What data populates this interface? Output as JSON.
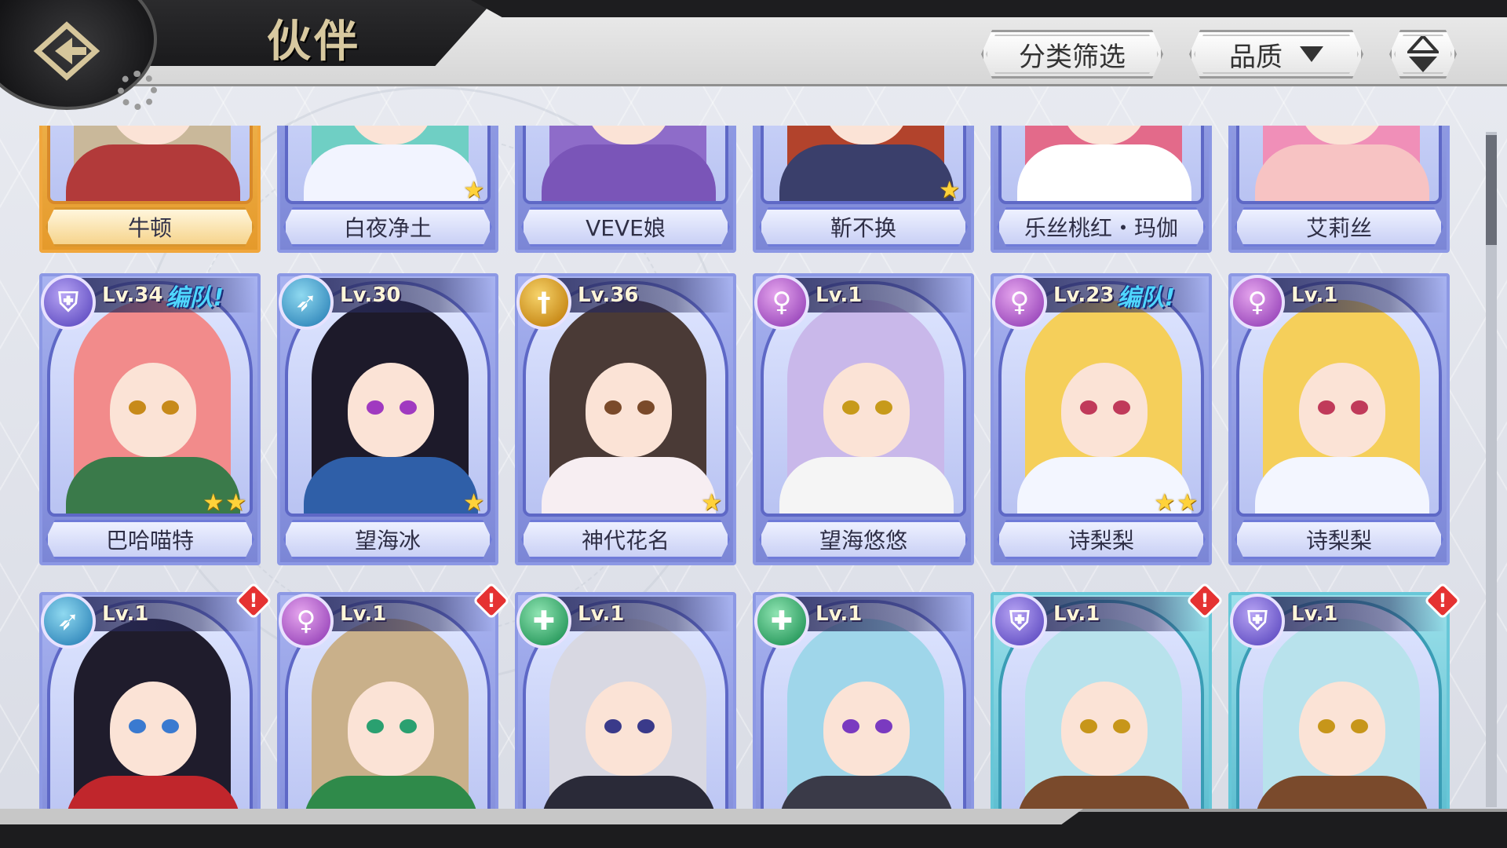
{
  "header": {
    "title": "伙伴",
    "filter_label": "分类筛选",
    "quality_label": "品质"
  },
  "colors": {
    "card_purple": "#8c98e4",
    "card_gold": "#f0a63c",
    "card_teal": "#67c7d8",
    "team_tag": "#4fd6ff",
    "level_text": "#fff6d8",
    "alert": "#e53232"
  },
  "scroll": {
    "position_fraction": 0.0
  },
  "rows": [
    {
      "cards": [
        {
          "name": "牛顿",
          "style": "gold",
          "stars": 0,
          "hair": "#c9b89a",
          "body": "#b23a3a",
          "eyes": "#6b4a2c"
        },
        {
          "name": "白夜净土",
          "style": "purple",
          "stars": 1,
          "hair": "#6fcfc4",
          "body": "#f2f4ff",
          "eyes": "#2a7f86"
        },
        {
          "name": "VEVE娘",
          "style": "purple",
          "stars": 0,
          "hair": "#8e6cc9",
          "body": "#7a55b8",
          "eyes": "#f2f2f2"
        },
        {
          "name": "靳不换",
          "style": "purple",
          "stars": 1,
          "hair": "#b2432c",
          "body": "#3a3f6b",
          "eyes": "#5a3a2a"
        },
        {
          "name": "乐丝桃红・玛伽",
          "style": "purple",
          "stars": 0,
          "hair": "#e36a8a",
          "body": "#ffffff",
          "eyes": "#c03c5a"
        },
        {
          "name": "艾莉丝",
          "style": "purple",
          "stars": 0,
          "hair": "#f08fb8",
          "body": "#f7c3c3",
          "eyes": "#c0507a"
        }
      ]
    },
    {
      "cards": [
        {
          "name": "巴哈喵特",
          "style": "purple",
          "stars": 2,
          "level": "Lv.34",
          "team": "编队!",
          "class": "tank",
          "class_icon": "shield-icon",
          "hair": "#f28b8b",
          "body": "#3a7a4a",
          "eyes": "#c78a1a"
        },
        {
          "name": "望海冰",
          "style": "purple",
          "stars": 1,
          "level": "Lv.30",
          "team": "",
          "class": "archer",
          "class_icon": "bow-icon",
          "hair": "#1d1a2a",
          "body": "#2f5fa8",
          "eyes": "#a03ac0"
        },
        {
          "name": "神代花名",
          "style": "purple",
          "stars": 1,
          "level": "Lv.36",
          "team": "",
          "class": "warrior",
          "class_icon": "sword-icon",
          "hair": "#4a3a36",
          "body": "#f7eef2",
          "eyes": "#7a4a2a"
        },
        {
          "name": "望海悠悠",
          "style": "purple",
          "stars": 0,
          "level": "Lv.1",
          "team": "",
          "class": "mage",
          "class_icon": "staff-icon",
          "hair": "#c9b8ea",
          "body": "#f5f5f5",
          "eyes": "#c79a1a"
        },
        {
          "name": "诗梨梨",
          "style": "purple",
          "stars": 2,
          "level": "Lv.23",
          "team": "编队!",
          "class": "mage",
          "class_icon": "staff-icon",
          "hair": "#f5cf5a",
          "body": "#f3f6ff",
          "eyes": "#c03a5a"
        },
        {
          "name": "诗梨梨",
          "style": "purple",
          "stars": 0,
          "level": "Lv.1",
          "team": "",
          "class": "mage",
          "class_icon": "staff-icon",
          "hair": "#f5cf5a",
          "body": "#f3f6ff",
          "eyes": "#c03a5a"
        }
      ]
    },
    {
      "cards": [
        {
          "name": "",
          "style": "purple",
          "stars": 0,
          "level": "Lv.1",
          "team": "",
          "class": "archer",
          "class_icon": "bow-icon",
          "alert": true,
          "hair": "#1f1c2c",
          "body": "#c0262c",
          "eyes": "#3a7ad0"
        },
        {
          "name": "",
          "style": "purple",
          "stars": 0,
          "level": "Lv.1",
          "team": "",
          "class": "mage",
          "class_icon": "staff-icon",
          "alert": true,
          "hair": "#c9b08a",
          "body": "#2f8a4a",
          "eyes": "#2aa070"
        },
        {
          "name": "",
          "style": "purple",
          "stars": 0,
          "level": "Lv.1",
          "team": "",
          "class": "healer",
          "class_icon": "cross-icon",
          "alert": false,
          "hair": "#d8d8e2",
          "body": "#2a2a38",
          "eyes": "#3a3a8a"
        },
        {
          "name": "",
          "style": "purple",
          "stars": 0,
          "level": "Lv.1",
          "team": "",
          "class": "healer",
          "class_icon": "cross-icon",
          "alert": false,
          "hair": "#9fd6ea",
          "body": "#3a3a48",
          "eyes": "#7a3ac0"
        },
        {
          "name": "",
          "style": "teal",
          "stars": 0,
          "level": "Lv.1",
          "team": "",
          "class": "tank",
          "class_icon": "shield-icon",
          "alert": true,
          "hair": "#b8e2ec",
          "body": "#7a4a2c",
          "eyes": "#c7961a"
        },
        {
          "name": "",
          "style": "teal",
          "stars": 0,
          "level": "Lv.1",
          "team": "",
          "class": "tank",
          "class_icon": "shield-icon",
          "alert": true,
          "hair": "#b8e2ec",
          "body": "#7a4a2c",
          "eyes": "#c7961a"
        }
      ]
    }
  ]
}
